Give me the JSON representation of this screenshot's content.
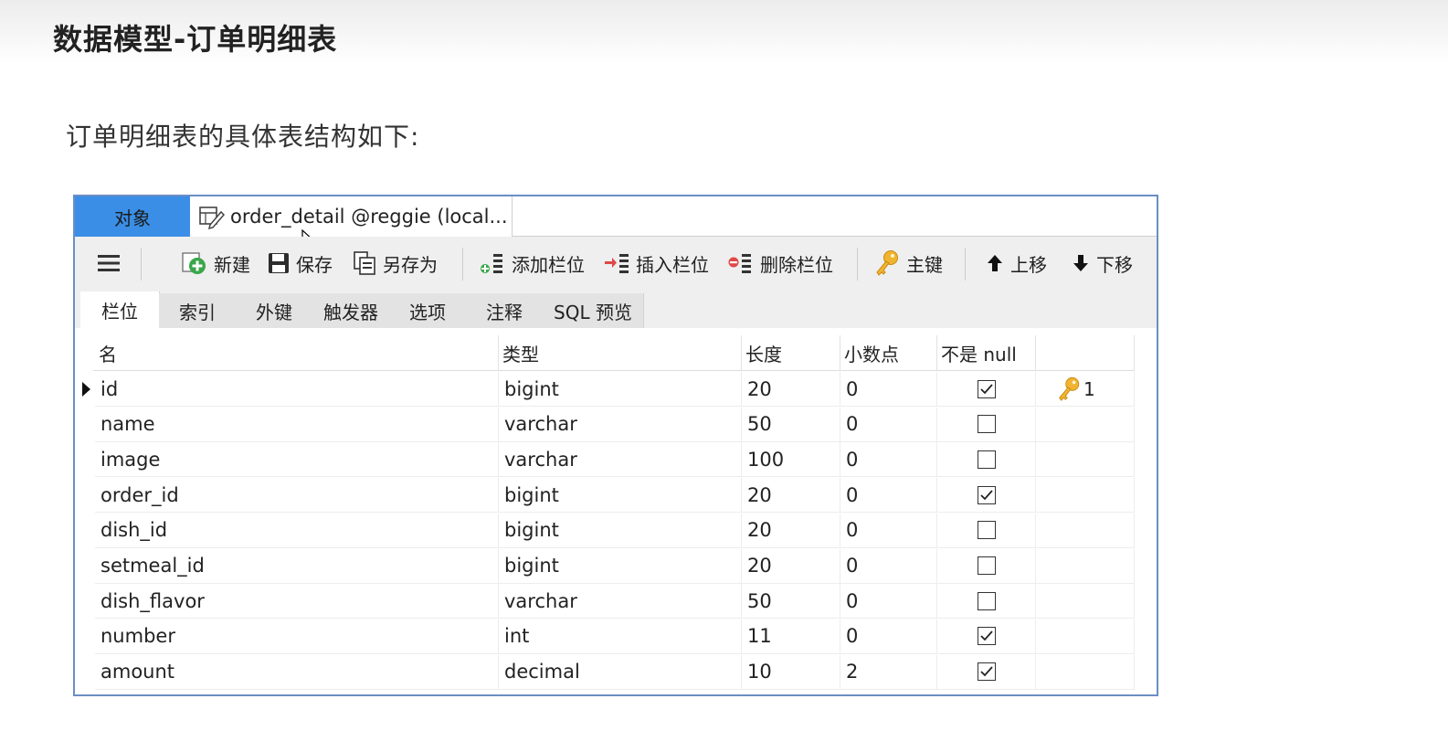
{
  "slide": {
    "title": "数据模型-订单明细表",
    "subtitle": "订单明细表的具体表结构如下:"
  },
  "window": {
    "tabs": {
      "objects_label": "对象",
      "document_label": "order_detail @reggie (local..."
    },
    "toolbar": {
      "new_label": "新建",
      "save_label": "保存",
      "save_as_label": "另存为",
      "add_field_label": "添加栏位",
      "insert_field_label": "插入栏位",
      "delete_field_label": "删除栏位",
      "primary_key_label": "主键",
      "move_up_label": "上移",
      "move_down_label": "下移"
    },
    "subtabs": [
      "栏位",
      "索引",
      "外键",
      "触发器",
      "选项",
      "注释",
      "SQL 预览"
    ],
    "columns": [
      "名",
      "类型",
      "长度",
      "小数点",
      "不是 null",
      ""
    ],
    "rows": [
      {
        "name": "id",
        "type": "bigint",
        "length": "20",
        "decimals": "0",
        "not_null": true,
        "key": "1",
        "selected": true
      },
      {
        "name": "name",
        "type": "varchar",
        "length": "50",
        "decimals": "0",
        "not_null": false,
        "key": ""
      },
      {
        "name": "image",
        "type": "varchar",
        "length": "100",
        "decimals": "0",
        "not_null": false,
        "key": ""
      },
      {
        "name": "order_id",
        "type": "bigint",
        "length": "20",
        "decimals": "0",
        "not_null": true,
        "key": ""
      },
      {
        "name": "dish_id",
        "type": "bigint",
        "length": "20",
        "decimals": "0",
        "not_null": false,
        "key": ""
      },
      {
        "name": "setmeal_id",
        "type": "bigint",
        "length": "20",
        "decimals": "0",
        "not_null": false,
        "key": ""
      },
      {
        "name": "dish_flavor",
        "type": "varchar",
        "length": "50",
        "decimals": "0",
        "not_null": false,
        "key": ""
      },
      {
        "name": "number",
        "type": "int",
        "length": "11",
        "decimals": "0",
        "not_null": true,
        "key": ""
      },
      {
        "name": "amount",
        "type": "decimal",
        "length": "10",
        "decimals": "2",
        "not_null": true,
        "key": ""
      }
    ]
  },
  "colors": {
    "objects_tab": "#3a8ee6",
    "window_border": "#6a8fc4",
    "toolbar_bg": "#efefef",
    "key_icon": "#f0b430",
    "new_icon": "#3aa64a",
    "delete_icon": "#e04848"
  },
  "icons": [
    "menu-icon",
    "new-icon",
    "save-icon",
    "save-as-icon",
    "add-field-icon",
    "insert-field-icon",
    "delete-field-icon",
    "key-icon",
    "arrow-up-icon",
    "arrow-down-icon",
    "table-edit-icon",
    "mouse-cursor-icon",
    "row-pointer-icon"
  ]
}
